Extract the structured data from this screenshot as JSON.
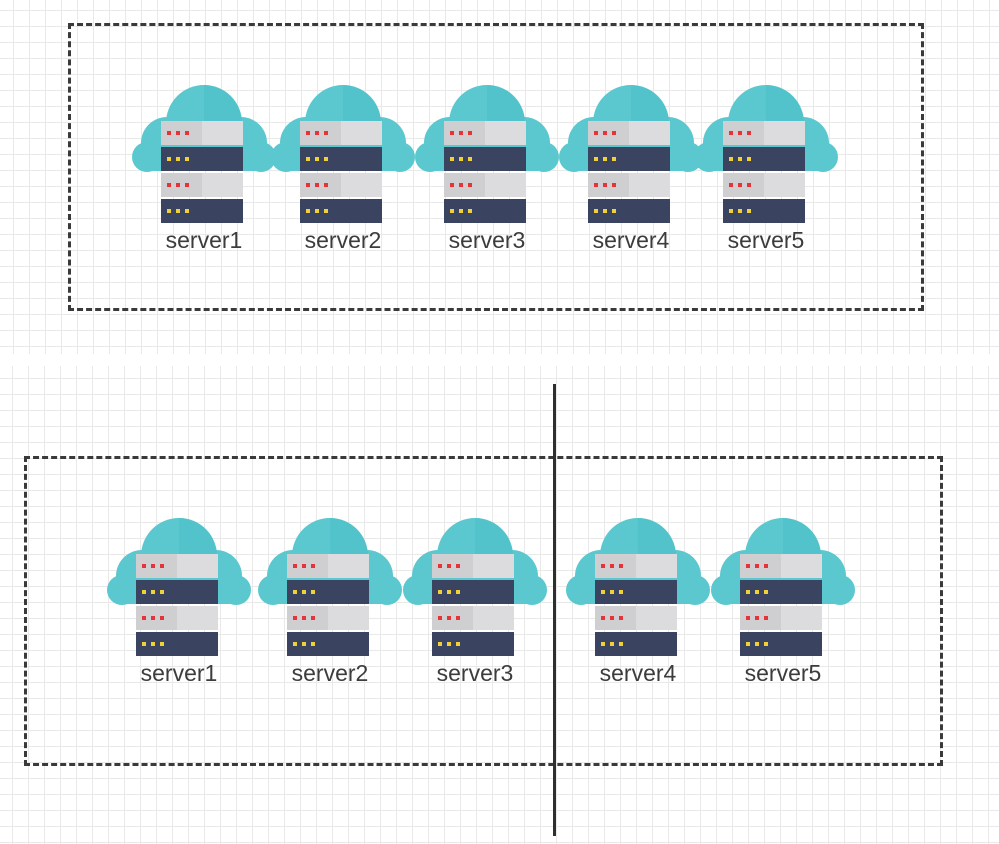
{
  "diagram": {
    "top_group": {
      "servers": [
        {
          "label": "server1"
        },
        {
          "label": "server2"
        },
        {
          "label": "server3"
        },
        {
          "label": "server4"
        },
        {
          "label": "server5"
        }
      ]
    },
    "bottom_group": {
      "servers": [
        {
          "label": "server1"
        },
        {
          "label": "server2"
        },
        {
          "label": "server3"
        },
        {
          "label": "server4"
        },
        {
          "label": "server5"
        }
      ]
    }
  },
  "colors": {
    "cloud": "#5bc8cf",
    "cloud_highlight": "#48bcc4",
    "server_light": "#cfcfd2",
    "server_light_shade": "#dcdcde",
    "server_dark": "#3a4360",
    "led_red": "#e8323a",
    "led_yellow": "#f0d236",
    "border": "#3a3a3a"
  }
}
